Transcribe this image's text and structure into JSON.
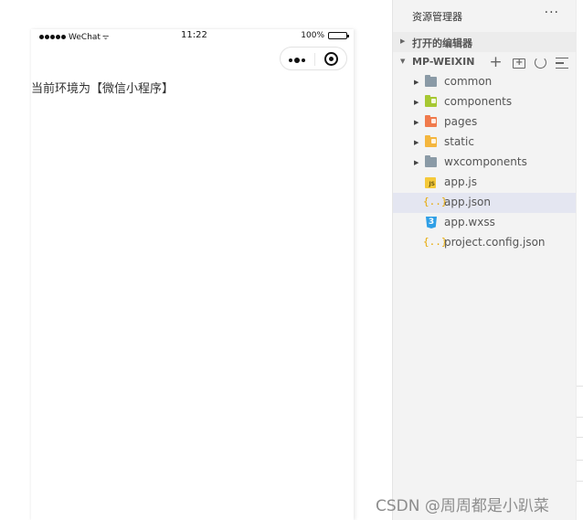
{
  "simulator": {
    "status_bar": {
      "carrier": "WeChat",
      "wifi_icon": "wifi-icon",
      "time": "11:22",
      "battery": "100%"
    },
    "capsule": {
      "more_icon": "more-dots-icon",
      "close_icon": "target-close-icon"
    },
    "content_text": "当前环境为【微信小程序】"
  },
  "explorer": {
    "title": "资源管理器",
    "more_label": "···",
    "open_editors_label": "打开的编辑器",
    "project_label": "MP-WEIXIN",
    "toolbar": {
      "new_file_label": "+",
      "new_file_icon": "new-file-icon",
      "new_folder_icon": "new-folder-icon",
      "refresh_icon": "refresh-icon",
      "collapse_icon": "collapse-all-icon"
    },
    "tree": [
      {
        "name": "common",
        "type": "folder",
        "color": "#8a9aa6",
        "chevron": "▶"
      },
      {
        "name": "components",
        "type": "folder",
        "color": "#a6c832",
        "chevron": "▶"
      },
      {
        "name": "pages",
        "type": "folder",
        "color": "#f07a4c",
        "chevron": "▶"
      },
      {
        "name": "static",
        "type": "folder",
        "color": "#f4b63e",
        "chevron": "▶"
      },
      {
        "name": "wxcomponents",
        "type": "folder",
        "color": "#8a9aa6",
        "chevron": "▶"
      },
      {
        "name": "app.js",
        "type": "js",
        "badge": "JS"
      },
      {
        "name": "app.json",
        "type": "json",
        "badge": "{..}",
        "selected": true
      },
      {
        "name": "app.wxss",
        "type": "css",
        "badge": "3"
      },
      {
        "name": "project.config.json",
        "type": "json",
        "badge": "{..}"
      }
    ]
  },
  "watermark": "CSDN @周周都是小趴菜",
  "colors": {
    "selected_row": "#e4e6f1",
    "sidebar_bg": "#f3f3f3"
  }
}
